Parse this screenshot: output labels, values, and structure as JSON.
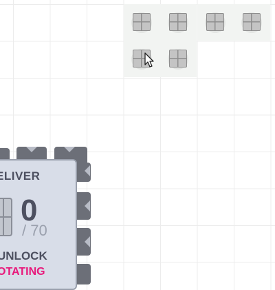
{
  "hub": {
    "label_deliver": "ELIVER",
    "delivered_count": "0",
    "goal_label": "/ 70",
    "label_unlock": "UNLOCK",
    "reward_label": "OTATING"
  },
  "shape_pieces": [
    {
      "icon": "square-shape-icon"
    },
    {
      "icon": "square-shape-icon"
    },
    {
      "icon": "square-shape-icon"
    },
    {
      "icon": "square-shape-icon"
    },
    {
      "icon": "square-shape-icon"
    },
    {
      "icon": "square-shape-icon"
    }
  ],
  "colors": {
    "grid_line": "#ececec",
    "hub_fill": "#d8dde8",
    "hub_text": "#4d5060",
    "reward_text": "#e8177a",
    "notch": "#6c6f78"
  }
}
